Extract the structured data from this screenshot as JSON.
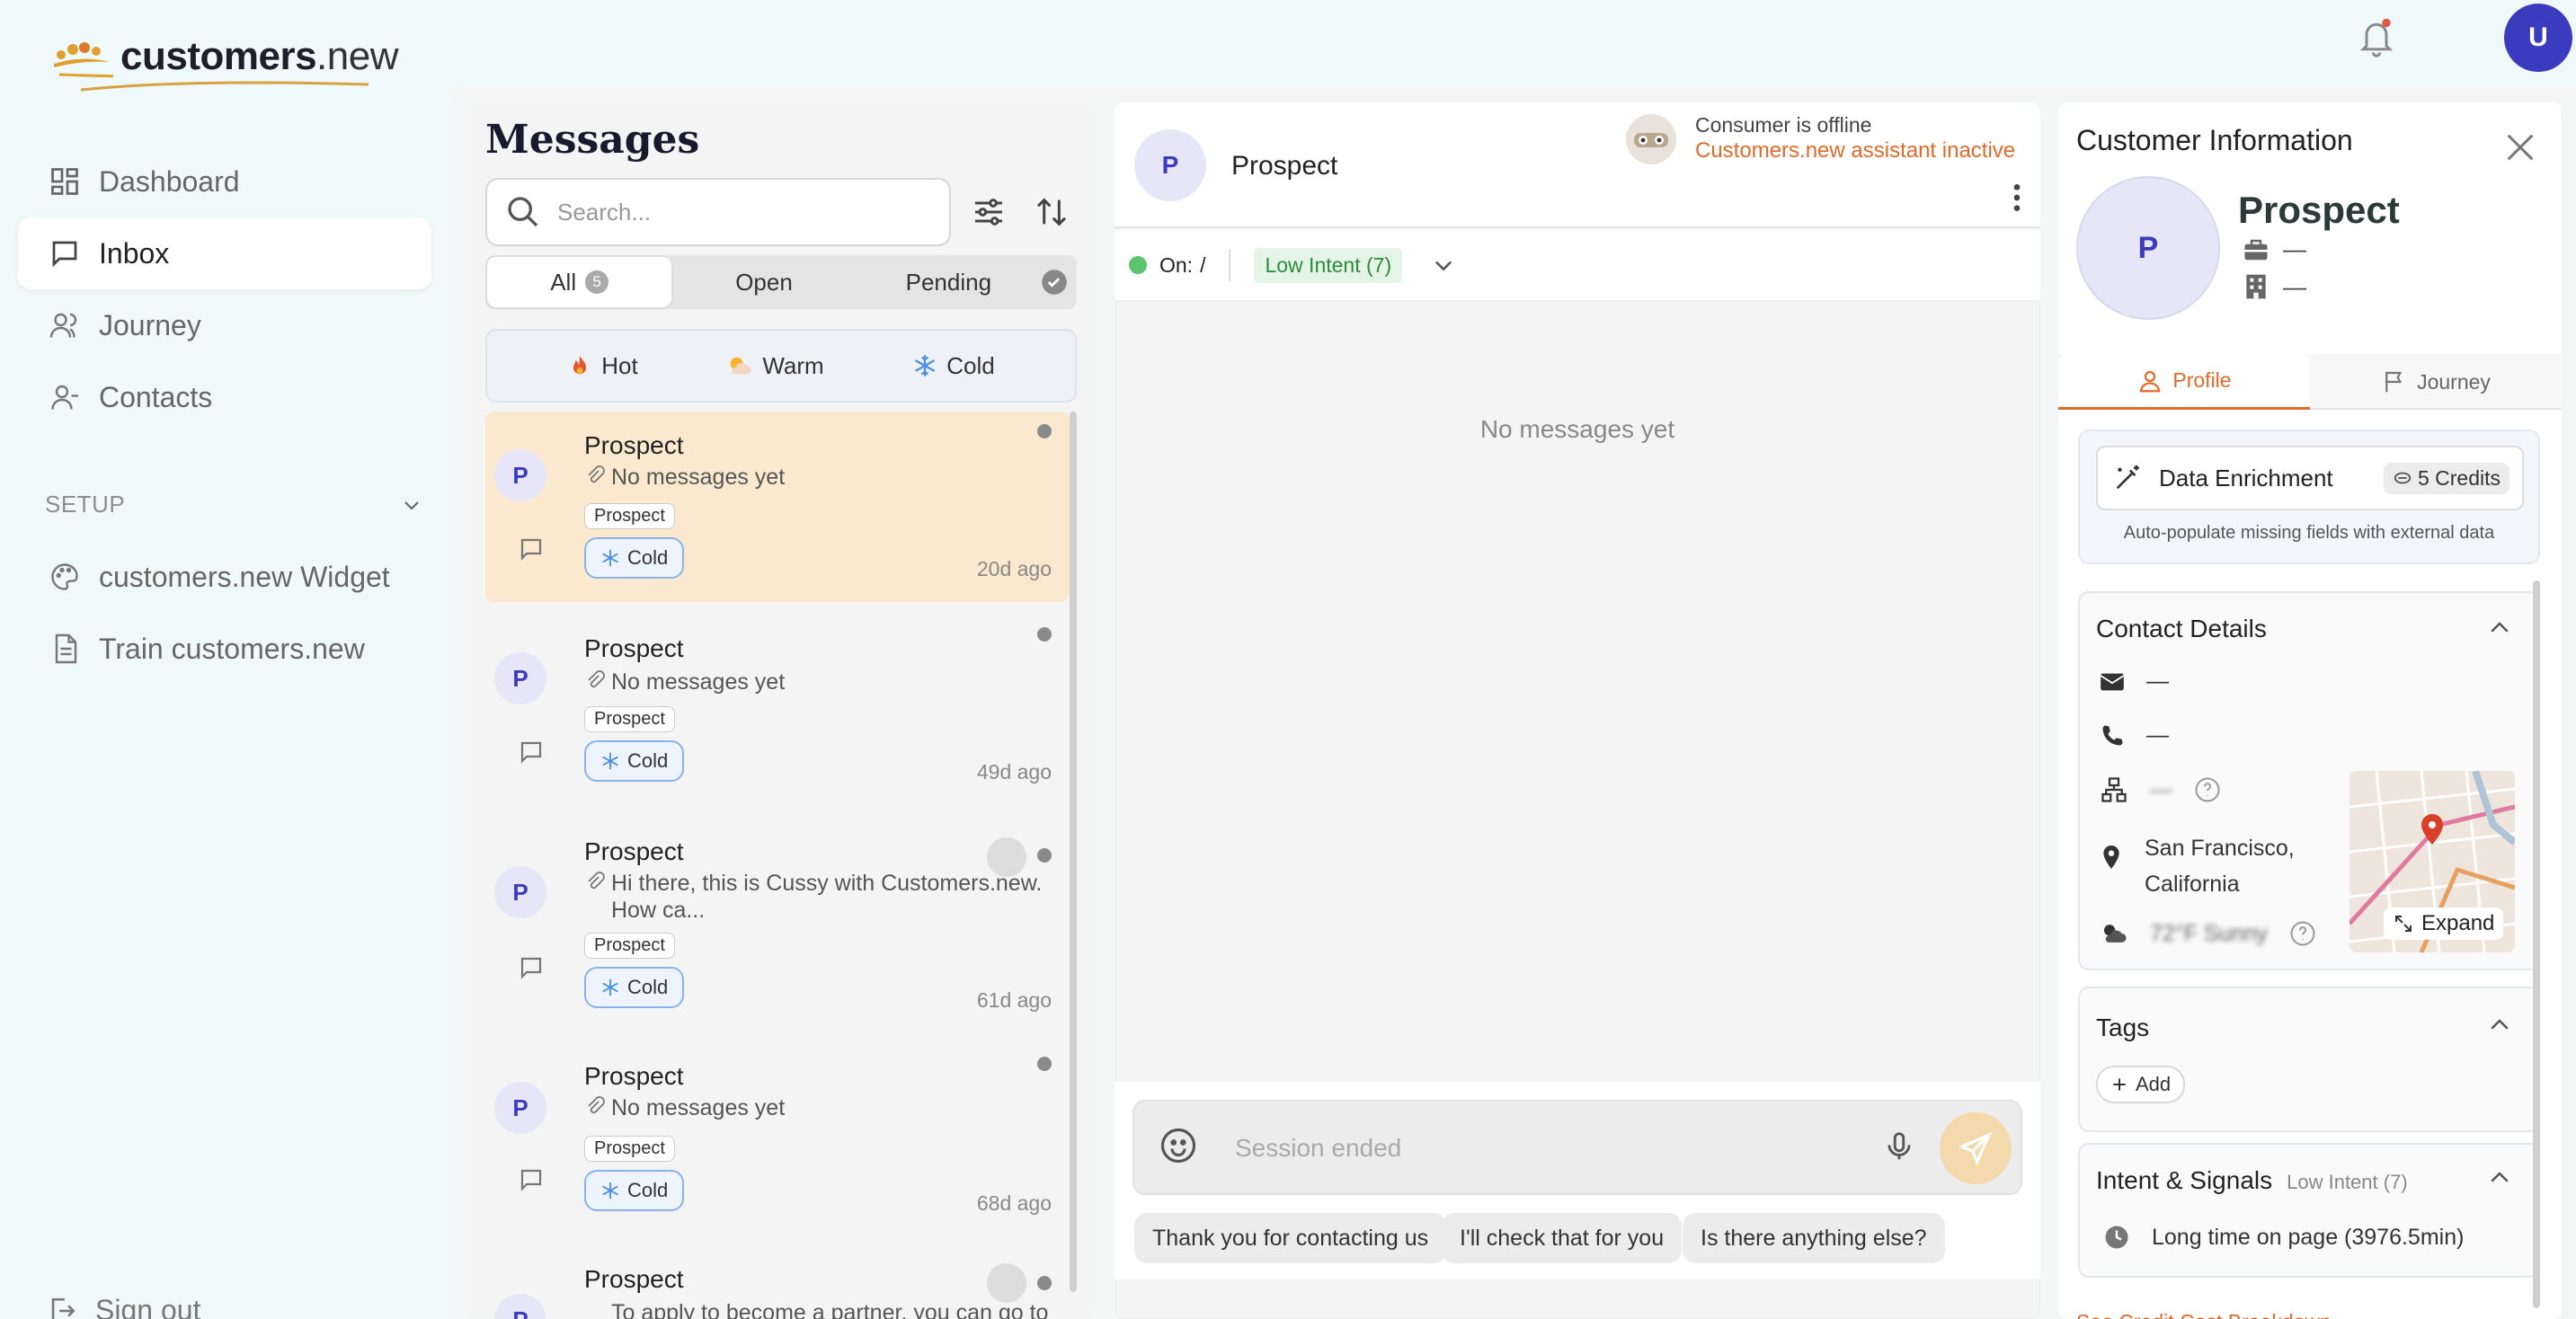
{
  "brand": {
    "name_bold": "customers",
    "name_suffix": ".new"
  },
  "nav": {
    "items": [
      {
        "label": "Dashboard",
        "icon": "dashboard-icon"
      },
      {
        "label": "Inbox",
        "icon": "inbox-icon"
      },
      {
        "label": "Journey",
        "icon": "journey-icon"
      },
      {
        "label": "Contacts",
        "icon": "contacts-icon"
      }
    ],
    "setup_label": "SETUP",
    "setup_items": [
      {
        "label": "customers.new Widget",
        "icon": "palette-icon"
      },
      {
        "label": "Train customers.new",
        "icon": "document-icon"
      }
    ],
    "sign_out": "Sign out"
  },
  "header": {
    "avatar_initial": "U"
  },
  "messages": {
    "title": "Messages",
    "search_placeholder": "Search...",
    "filters": {
      "all": "All",
      "all_count": "5",
      "open": "Open",
      "pending": "Pending"
    },
    "temps": {
      "hot": "Hot",
      "warm": "Warm",
      "cold": "Cold"
    },
    "conversations": [
      {
        "name": "Prospect",
        "snippet": "No messages yet",
        "tag": "Prospect",
        "temp": "Cold",
        "ago": "20d ago",
        "initial": "P"
      },
      {
        "name": "Prospect",
        "snippet": "No messages yet",
        "tag": "Prospect",
        "temp": "Cold",
        "ago": "49d ago",
        "initial": "P"
      },
      {
        "name": "Prospect",
        "snippet": "Hi there, this is Cussy with Customers.new. How ca...",
        "tag": "Prospect",
        "temp": "Cold",
        "ago": "61d ago",
        "initial": "P"
      },
      {
        "name": "Prospect",
        "snippet": "No messages yet",
        "tag": "Prospect",
        "temp": "Cold",
        "ago": "68d ago",
        "initial": "P"
      },
      {
        "name": "Prospect",
        "snippet": "To apply to become a partner, you can go to",
        "initial": "P"
      }
    ]
  },
  "chat": {
    "initial": "P",
    "name": "Prospect",
    "offline": "Consumer is offline",
    "assistant": "Customers.new assistant inactive",
    "on_label": "On:",
    "on_value": "/",
    "intent": "Low Intent (7)",
    "empty": "No messages yet",
    "composer_placeholder": "Session ended",
    "quick_replies": [
      "Thank you for contacting us",
      "I'll check that for you",
      "Is there anything else?"
    ]
  },
  "info": {
    "title": "Customer Information",
    "initial": "P",
    "name": "Prospect",
    "company": "—",
    "org": "—",
    "tabs": {
      "profile": "Profile",
      "journey": "Journey"
    },
    "enrichment": {
      "label": "Data Enrichment",
      "credits": "5 Credits",
      "sub": "Auto-populate missing fields with external data"
    },
    "contact": {
      "title": "Contact Details",
      "email": "—",
      "phone": "—",
      "network": "—",
      "location": "San Francisco, California",
      "weather": "72°F Sunny",
      "expand": "Expand"
    },
    "tags": {
      "title": "Tags",
      "add": "Add"
    },
    "intent": {
      "title": "Intent & Signals",
      "level": "Low Intent (7)",
      "signal": "Long time on page (3976.5min)"
    },
    "breakdown": "See Credit Cost Breakdown"
  },
  "colors": {
    "accent": "#e06a2a",
    "brand_blue": "#3b3bbf",
    "selected_row": "#fbe9cf",
    "online": "#5cc36e"
  }
}
